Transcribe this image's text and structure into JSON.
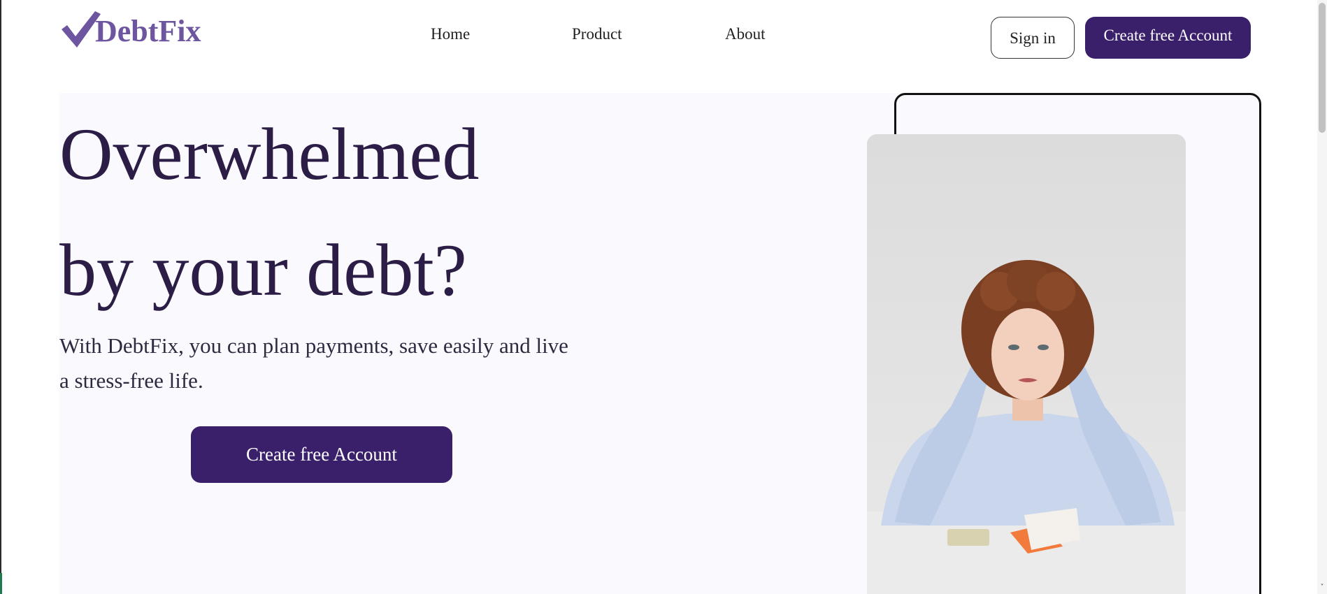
{
  "brand": {
    "name": "DebtFix",
    "logo_icon": "checkmark-icon",
    "color": "#6e559f"
  },
  "nav": {
    "items": [
      {
        "label": "Home"
      },
      {
        "label": "Product"
      },
      {
        "label": "About"
      }
    ]
  },
  "header": {
    "signin_label": "Sign in",
    "create_account_label": "Create free Account"
  },
  "hero": {
    "title_line1": "Overwhelmed",
    "title_line2": "by your debt?",
    "subtitle": "With DebtFix, you can plan payments, save easily and live a stress-free life.",
    "cta_label": "Create free Account",
    "image_icon": "stressed-woman-photo"
  },
  "colors": {
    "primary": "#3a1f6b",
    "heading": "#2b1d45",
    "hero_background": "#faf9fe"
  }
}
